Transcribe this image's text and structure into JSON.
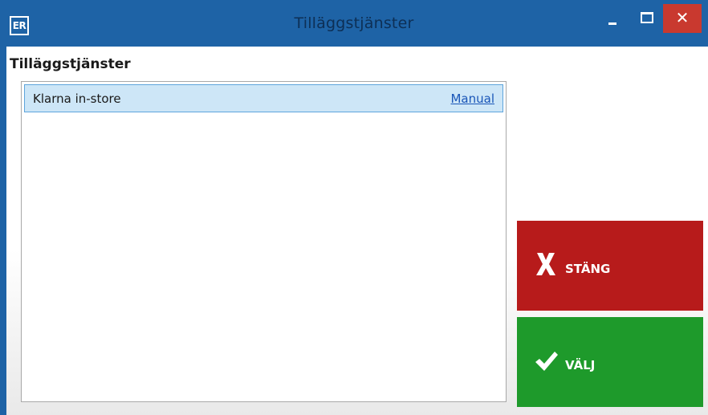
{
  "window": {
    "app_icon_text": "ER",
    "title": "Tilläggstjänster",
    "minimize_glyph": "–",
    "close_glyph": "✕"
  },
  "main": {
    "section_title": "Tilläggstjänster",
    "list": {
      "items": [
        {
          "label": "Klarna in-store",
          "link": "Manual"
        }
      ]
    }
  },
  "actions": {
    "close_label": "STÄNG",
    "close_icon": "x-icon",
    "select_label": "VÄLJ",
    "select_icon": "check-icon"
  },
  "colors": {
    "titlebar": "#1e63a6",
    "close_button": "#b71b1b",
    "select_button": "#1e9a2b",
    "selected_row": "#cde6f7",
    "link": "#1a56b8"
  }
}
